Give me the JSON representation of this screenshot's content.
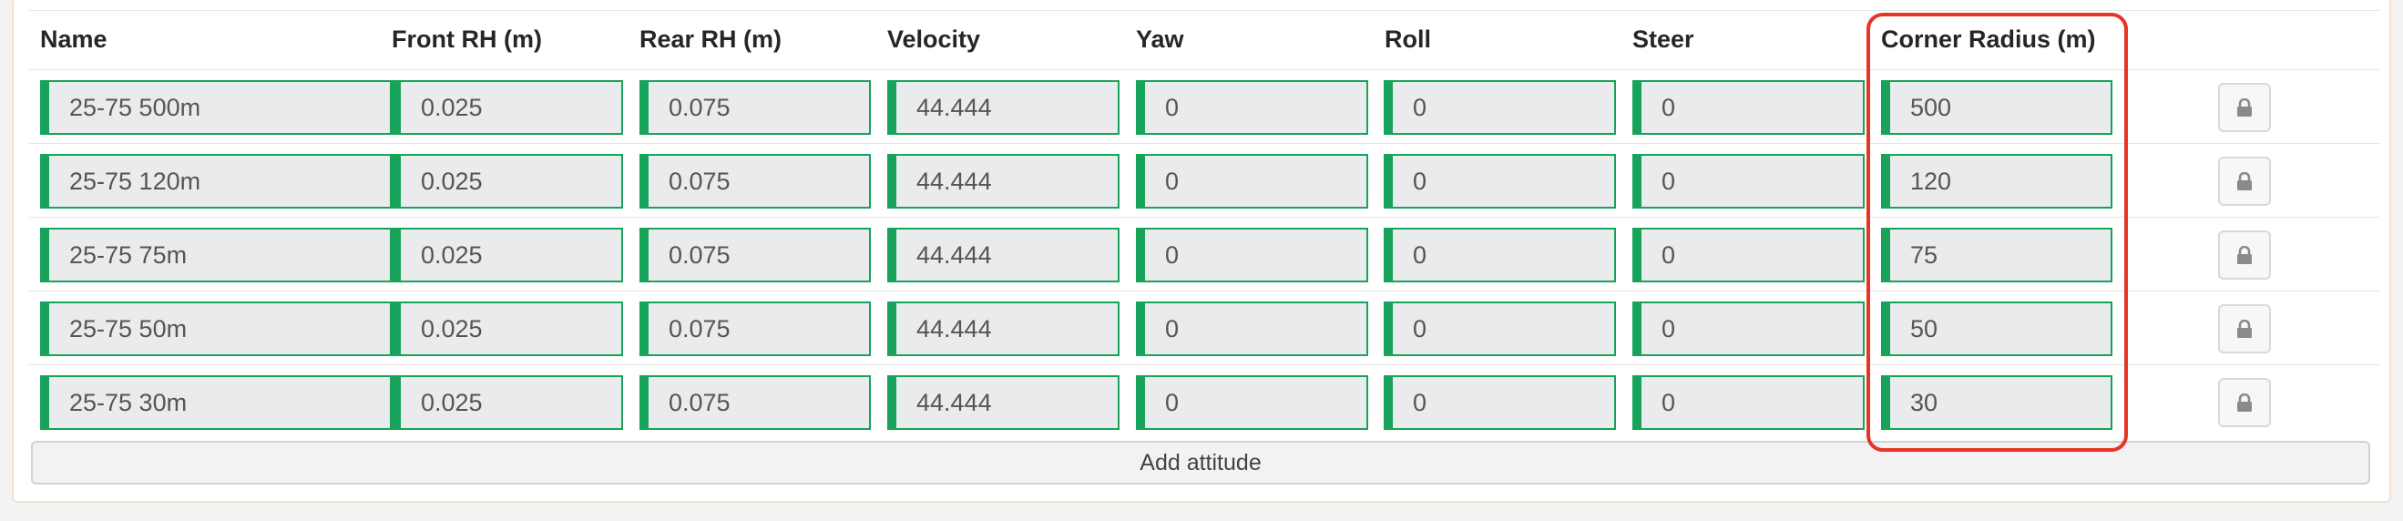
{
  "columns": {
    "name": "Name",
    "front_rh": "Front RH (m)",
    "rear_rh": "Rear RH (m)",
    "velocity": "Velocity",
    "yaw": "Yaw",
    "roll": "Roll",
    "steer": "Steer",
    "corner_radius": "Corner Radius (m)"
  },
  "rows": [
    {
      "name": "25-75 500m",
      "front_rh": "0.025",
      "rear_rh": "0.075",
      "velocity": "44.444",
      "yaw": "0",
      "roll": "0",
      "steer": "0",
      "corner_radius": "500"
    },
    {
      "name": "25-75 120m",
      "front_rh": "0.025",
      "rear_rh": "0.075",
      "velocity": "44.444",
      "yaw": "0",
      "roll": "0",
      "steer": "0",
      "corner_radius": "120"
    },
    {
      "name": "25-75 75m",
      "front_rh": "0.025",
      "rear_rh": "0.075",
      "velocity": "44.444",
      "yaw": "0",
      "roll": "0",
      "steer": "0",
      "corner_radius": "75"
    },
    {
      "name": "25-75 50m",
      "front_rh": "0.025",
      "rear_rh": "0.075",
      "velocity": "44.444",
      "yaw": "0",
      "roll": "0",
      "steer": "0",
      "corner_radius": "50"
    },
    {
      "name": "25-75 30m",
      "front_rh": "0.025",
      "rear_rh": "0.075",
      "velocity": "44.444",
      "yaw": "0",
      "roll": "0",
      "steer": "0",
      "corner_radius": "30"
    }
  ],
  "row_action_icon": "lock-icon",
  "add_button_label": "Add attitude",
  "colors": {
    "valid_border": "#17a35a",
    "highlight": "#e63427",
    "field_bg": "#e9ebed"
  }
}
